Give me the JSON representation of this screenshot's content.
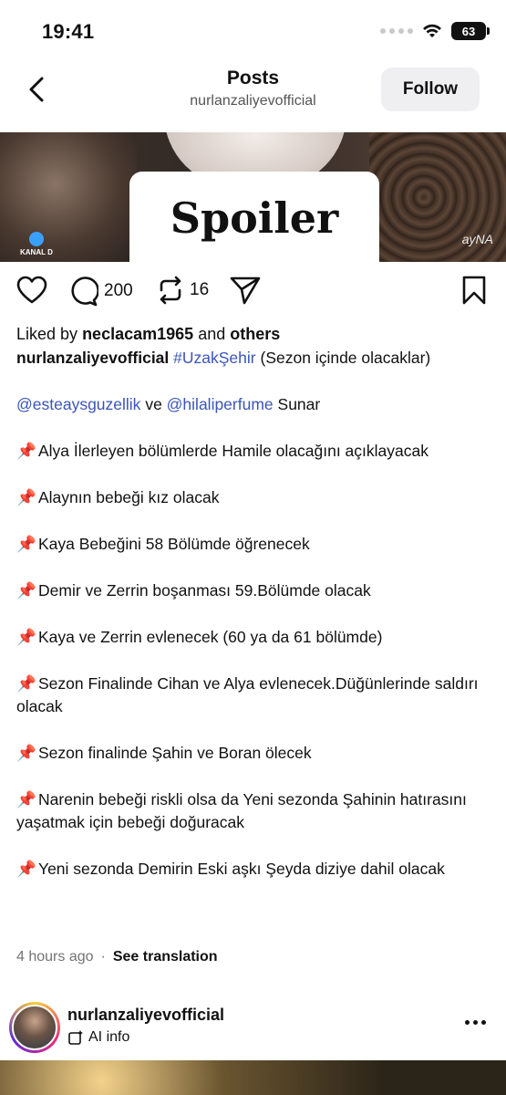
{
  "status_bar": {
    "time": "19:41",
    "battery": "63"
  },
  "nav": {
    "title": "Posts",
    "username": "nurlanzaliyevofficial",
    "follow_label": "Follow"
  },
  "media": {
    "overlay_text": "Spoiler",
    "left_logo": "KANAL D",
    "right_logo": "ayNA"
  },
  "actions": {
    "comments_count": "200",
    "reposts_count": "16"
  },
  "likes": {
    "prefix": "Liked by",
    "user": "neclacam1965",
    "and": "and",
    "others": "others"
  },
  "caption": {
    "author": "nurlanzaliyevofficial",
    "hashtag": "#UzakŞehir",
    "intro": "(Sezon içinde olacaklar)",
    "mention1": "@esteaysguzellik",
    "ve": "ve",
    "mention2": "@hilaliperfume",
    "sunar": "Sunar",
    "pin": "📌",
    "items": [
      "Alya İlerleyen bölümlerde Hamile olacağını açıklayacak",
      "Alaynın bebeği kız olacak",
      "Kaya Bebeğini 58 Bölümde öğrenecek",
      "Demir ve Zerrin boşanması 59.Bölümde olacak",
      "Kaya ve Zerrin evlenecek (60 ya da 61 bölümde)",
      "Sezon Finalinde Cihan ve Alya evlenecek.Düğünlerinde saldırı olacak",
      "Sezon finalinde Şahin ve Boran ölecek",
      "Narenin bebeği riskli olsa da Yeni sezonda Şahinin hatırasını yaşatmak için bebeği doğuracak",
      "Yeni sezonda Demirin Eski aşkı Şeyda diziye dahil olacak"
    ]
  },
  "meta": {
    "time_ago": "4 hours ago",
    "separator": "·",
    "see_translation": "See translation"
  },
  "next_post": {
    "username": "nurlanzaliyevofficial",
    "ai_info": "AI info"
  },
  "icons": [
    "back-chevron-icon",
    "heart-icon",
    "comment-icon",
    "repost-icon",
    "share-icon",
    "bookmark-icon",
    "more-icon",
    "ai-info-icon",
    "wifi-icon"
  ]
}
